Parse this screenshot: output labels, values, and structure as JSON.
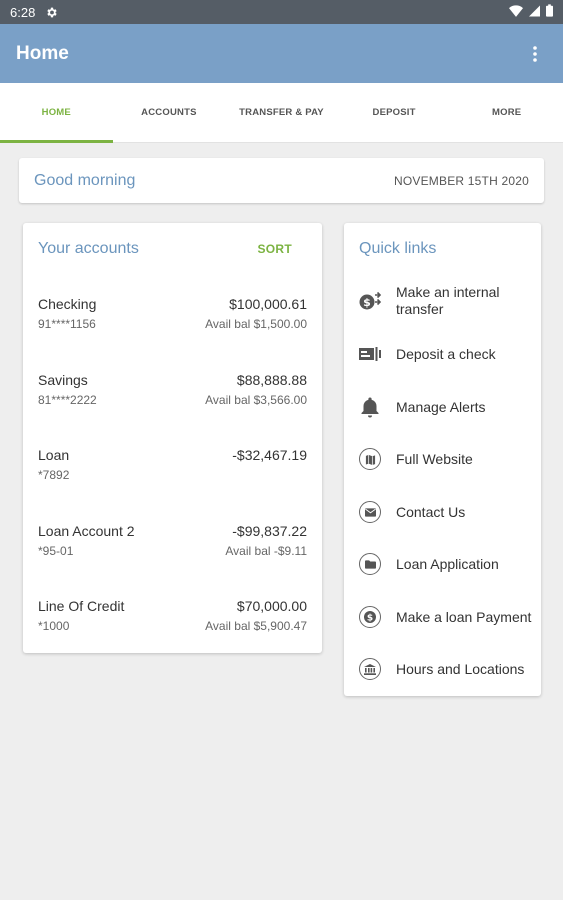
{
  "status": {
    "time": "6:28"
  },
  "appbar": {
    "title": "Home"
  },
  "tabs": [
    {
      "label": "HOME",
      "active": true
    },
    {
      "label": "ACCOUNTS",
      "active": false
    },
    {
      "label": "TRANSFER & PAY",
      "active": false
    },
    {
      "label": "DEPOSIT",
      "active": false
    },
    {
      "label": "MORE",
      "active": false
    }
  ],
  "greeting": {
    "text": "Good morning",
    "date": "NOVEMBER 15TH 2020"
  },
  "accounts": {
    "title": "Your accounts",
    "sort_label": "SORT",
    "items": [
      {
        "name": "Checking",
        "number": "91****1156",
        "amount": "$100,000.61",
        "avail": "Avail bal $1,500.00"
      },
      {
        "name": "Savings",
        "number": "81****2222",
        "amount": "$88,888.88",
        "avail": "Avail bal $3,566.00"
      },
      {
        "name": "Loan",
        "number": "*7892",
        "amount": "-$32,467.19",
        "avail": ""
      },
      {
        "name": "Loan Account 2",
        "number": "*95-01",
        "amount": "-$99,837.22",
        "avail": "Avail bal -$9.11"
      },
      {
        "name": "Line Of Credit",
        "number": "*1000",
        "amount": "$70,000.00",
        "avail": "Avail bal $5,900.47"
      }
    ]
  },
  "quick_links": {
    "title": "Quick links",
    "items": [
      {
        "label": "Make an internal transfer",
        "icon": "transfer-money-icon"
      },
      {
        "label": "Deposit a check",
        "icon": "check-deposit-icon"
      },
      {
        "label": "Manage Alerts",
        "icon": "bell-icon"
      },
      {
        "label": "Full Website",
        "icon": "map-icon"
      },
      {
        "label": "Contact Us",
        "icon": "mail-icon"
      },
      {
        "label": "Loan Application",
        "icon": "folder-icon"
      },
      {
        "label": "Make a loan Payment",
        "icon": "dollar-icon"
      },
      {
        "label": "Hours and Locations",
        "icon": "bank-icon"
      }
    ]
  },
  "colors": {
    "appbar": "#7aa0c7",
    "accent": "#7cb342",
    "heading": "#6b95bd",
    "background": "#eeeeee"
  }
}
